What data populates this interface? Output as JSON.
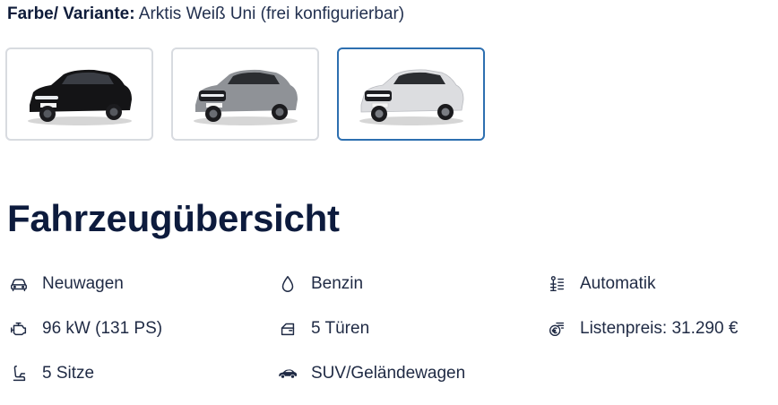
{
  "variant": {
    "label": "Farbe/ Variante:",
    "value": "Arktis Weiß Uni (frei konfigurierbar)"
  },
  "swatches": [
    {
      "name": "black",
      "color": "#141416",
      "selected": false
    },
    {
      "name": "silver",
      "color": "#8f9297",
      "selected": false
    },
    {
      "name": "white",
      "color": "#dcdde0",
      "selected": true
    }
  ],
  "accent_color": "#2d6fb0",
  "heading": "Fahrzeugübersicht",
  "specs": [
    {
      "icon": "car-front-icon",
      "label": "Neuwagen"
    },
    {
      "icon": "fuel-drop-icon",
      "label": "Benzin"
    },
    {
      "icon": "gearbox-icon",
      "label": "Automatik"
    },
    {
      "icon": "engine-icon",
      "label": "96 kW (131 PS)"
    },
    {
      "icon": "car-door-icon",
      "label": "5 Türen"
    },
    {
      "icon": "price-tag-icon",
      "label": "Listenpreis: 31.290 €"
    },
    {
      "icon": "car-seat-icon",
      "label": "5 Sitze"
    },
    {
      "icon": "car-side-icon",
      "label": "SUV/Geländewagen"
    }
  ]
}
